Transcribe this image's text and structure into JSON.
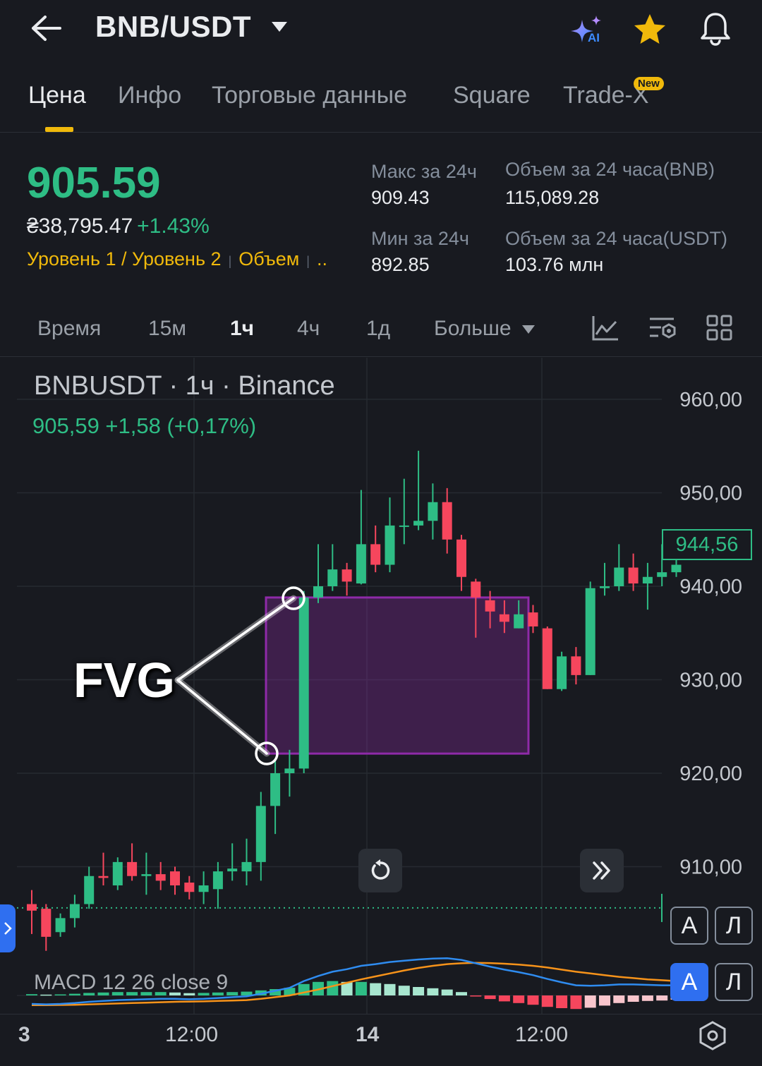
{
  "header": {
    "title": "BNB/USDT",
    "ai_badge": "AI"
  },
  "tabs": [
    {
      "label": "Цена",
      "active": true
    },
    {
      "label": "Инфо"
    },
    {
      "label": "Торговые данные"
    },
    {
      "label": "Square"
    },
    {
      "label": "Trade-X",
      "badge": "New"
    }
  ],
  "price": {
    "last": "905.59",
    "fiat": "₴38,795.47",
    "change_pct": "+1.43%",
    "level_link": "Уровень 1 / Уровень 2",
    "volume_link": "Объем",
    "more": ".."
  },
  "stats": {
    "high_label": "Макс за 24ч",
    "high_value": "909.43",
    "low_label": "Мин за 24ч",
    "low_value": "892.85",
    "vol_base_label": "Объем за 24 часа(BNB)",
    "vol_base_value": "115,089.28",
    "vol_quote_label": "Объем за 24 часа(USDT)",
    "vol_quote_value": "103.76 млн"
  },
  "intervals": [
    {
      "label": "Время"
    },
    {
      "label": "15м"
    },
    {
      "label": "1ч",
      "active": true
    },
    {
      "label": "4ч"
    },
    {
      "label": "1д"
    },
    {
      "label": "Больше"
    }
  ],
  "chart_header": {
    "title": "BNBUSDT · 1ч · Binance",
    "summary": "905,59  +1,58 (+0,17%)"
  },
  "annotation": {
    "label": "FVG"
  },
  "macd_label": "MACD 12 26 close 9",
  "chart_data": {
    "type": "candlestick",
    "y_ticks": [
      "960,00",
      "950,00",
      "940,00",
      "930,00",
      "920,00",
      "910,00"
    ],
    "current_price_tag": "944,56",
    "x_ticks": [
      "3",
      "12:00",
      "14",
      "12:00"
    ],
    "colors": {
      "up": "#2ebd85",
      "down": "#f6465d",
      "fvg": "#8e2aa8"
    },
    "fvg_zone": {
      "top": 938.8,
      "bottom": 922.1
    },
    "candles": [
      [
        906.0,
        905.3,
        907.5,
        902.8
      ],
      [
        905.5,
        902.5,
        906.0,
        901.0
      ],
      [
        903.0,
        904.5,
        905.0,
        902.5
      ],
      [
        904.5,
        906.0,
        907.0,
        903.5
      ],
      [
        906.0,
        909.0,
        910.0,
        905.5
      ],
      [
        909.0,
        908.8,
        911.5,
        908.0
      ],
      [
        908.0,
        910.5,
        911.0,
        907.5
      ],
      [
        910.5,
        909.0,
        912.5,
        908.5
      ],
      [
        909.0,
        909.2,
        911.5,
        907.0
      ],
      [
        909.2,
        908.5,
        910.5,
        907.5
      ],
      [
        909.5,
        908.0,
        910.0,
        907.0
      ],
      [
        908.3,
        907.3,
        909.0,
        906.5
      ],
      [
        907.3,
        908.0,
        909.5,
        906.0
      ],
      [
        907.6,
        909.5,
        910.5,
        905.5
      ],
      [
        909.5,
        909.8,
        912.5,
        908.5
      ],
      [
        909.5,
        910.5,
        913.0,
        908.0
      ],
      [
        910.5,
        916.5,
        918.0,
        908.5
      ],
      [
        916.5,
        920.0,
        921.5,
        913.5
      ],
      [
        920.0,
        920.5,
        922.5,
        917.5
      ],
      [
        920.5,
        938.8,
        939.5,
        920.0
      ],
      [
        938.8,
        940.0,
        944.5,
        938.2
      ],
      [
        940.0,
        941.8,
        944.5,
        939.5
      ],
      [
        941.8,
        940.5,
        942.5,
        939.0
      ],
      [
        940.3,
        944.5,
        950.3,
        940.2
      ],
      [
        944.5,
        942.3,
        946.5,
        941.5
      ],
      [
        942.3,
        946.5,
        949.5,
        941.5
      ],
      [
        946.5,
        946.5,
        951.5,
        944.5
      ],
      [
        946.5,
        947.0,
        954.5,
        946.0
      ],
      [
        947.0,
        949.0,
        951.0,
        945.0
      ],
      [
        949.0,
        945.0,
        950.5,
        943.5
      ],
      [
        945.0,
        941.0,
        945.5,
        939.5
      ],
      [
        940.5,
        938.8,
        940.8,
        934.5
      ],
      [
        938.5,
        937.3,
        939.5,
        935.5
      ],
      [
        937.0,
        936.2,
        938.5,
        935.0
      ],
      [
        935.5,
        937.0,
        938.5,
        935.5
      ],
      [
        937.2,
        935.7,
        938.0,
        935.0
      ],
      [
        935.5,
        929.0,
        935.7,
        929.0
      ],
      [
        929.0,
        932.5,
        933.0,
        928.8
      ],
      [
        932.5,
        930.5,
        933.5,
        929.5
      ],
      [
        930.5,
        939.8,
        940.5,
        930.5
      ],
      [
        939.8,
        940.0,
        942.5,
        939.0
      ],
      [
        940.0,
        942.0,
        944.5,
        939.5
      ],
      [
        942.0,
        940.3,
        943.5,
        939.5
      ],
      [
        940.3,
        941.0,
        942.5,
        937.5
      ],
      [
        941.0,
        941.5,
        944.5,
        940.0
      ],
      [
        941.5,
        942.3,
        945.5,
        941.0
      ]
    ],
    "macd": {
      "macd_line": [
        -4,
        -4.2,
        -4,
        -3.6,
        -3,
        -2.6,
        -2.2,
        -2,
        -1.8,
        -1.6,
        -1.6,
        -1.8,
        -1.6,
        -1.2,
        -0.8,
        -0.4,
        0.8,
        2.2,
        3.6,
        6.8,
        9.2,
        11.2,
        12.4,
        14,
        14.8,
        15.8,
        16.4,
        17,
        17.4,
        17.6,
        16.8,
        15.2,
        13.6,
        12.2,
        11,
        9.6,
        7.8,
        6.2,
        4.8,
        4.6,
        4.8,
        5.2,
        5.2,
        5.0,
        4.8,
        4.8
      ],
      "signal_line": [
        -4.6,
        -4.6,
        -4.5,
        -4.4,
        -4.2,
        -4,
        -3.8,
        -3.6,
        -3.4,
        -3.2,
        -3,
        -2.9,
        -2.8,
        -2.6,
        -2.4,
        -2.2,
        -1.6,
        -0.8,
        0,
        1.4,
        2.8,
        4.4,
        6,
        7.6,
        9,
        10.4,
        11.8,
        13,
        14,
        14.8,
        15.2,
        15.4,
        15.3,
        15,
        14.6,
        14,
        13.2,
        12.2,
        11.2,
        10.4,
        9.6,
        8.8,
        8.2,
        7.6,
        7.2,
        6.8
      ],
      "histogram": [
        0.6,
        0.4,
        0.5,
        0.8,
        1.2,
        1.4,
        1.6,
        1.6,
        1.6,
        1.6,
        1.4,
        1.1,
        1.2,
        1.4,
        1.6,
        1.8,
        2.4,
        3,
        3.6,
        5.4,
        6.4,
        6.8,
        6.4,
        6.4,
        5.8,
        5.4,
        4.6,
        4,
        3.4,
        2.8,
        1.6,
        -0.2,
        -1.7,
        -2.8,
        -3.6,
        -4.4,
        -5.4,
        -6,
        -6.4,
        -5.8,
        -4.8,
        -3.6,
        -3,
        -2.6,
        -2.4,
        -2
      ]
    }
  }
}
